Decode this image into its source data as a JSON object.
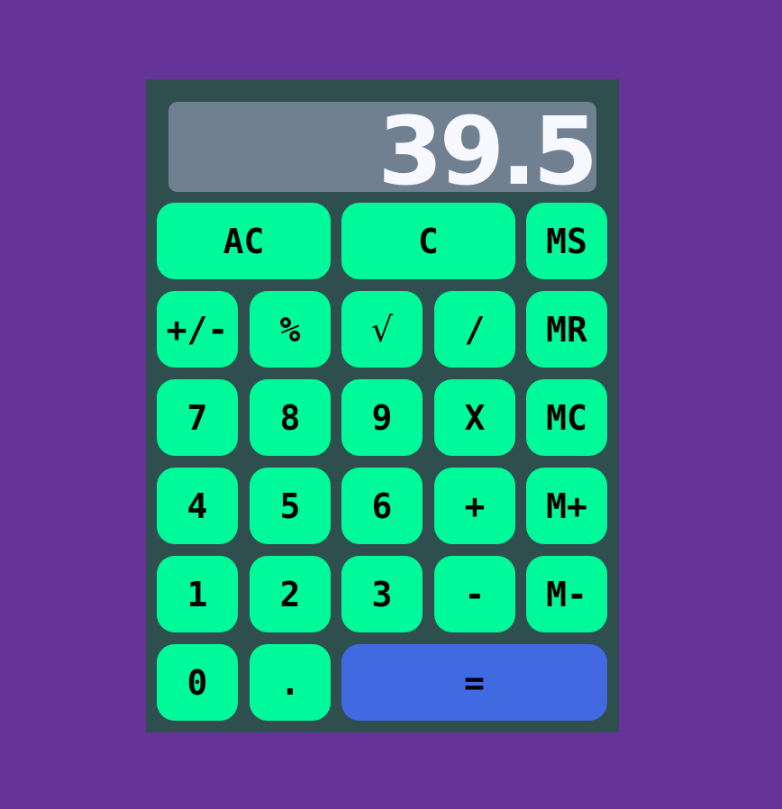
{
  "display": {
    "value": "39.5"
  },
  "colors": {
    "page_background": "#663399",
    "calculator_body": "#2f4f4f",
    "display_background": "#708090",
    "display_text": "#f8f8ff",
    "key_background": "#00fa9a",
    "equals_background": "#4169e1",
    "key_text": "#000000"
  },
  "keys": {
    "all_clear": "AC",
    "clear": "C",
    "memory_store": "MS",
    "toggle_sign": "+/-",
    "percent": "%",
    "square_root": "√",
    "divide": "/",
    "memory_recall": "MR",
    "seven": "7",
    "eight": "8",
    "nine": "9",
    "multiply": "X",
    "memory_clear": "MC",
    "four": "4",
    "five": "5",
    "six": "6",
    "add": "+",
    "memory_add": "M+",
    "one": "1",
    "two": "2",
    "three": "3",
    "subtract": "-",
    "memory_subtract": "M-",
    "zero": "0",
    "decimal": ".",
    "equals": "="
  }
}
